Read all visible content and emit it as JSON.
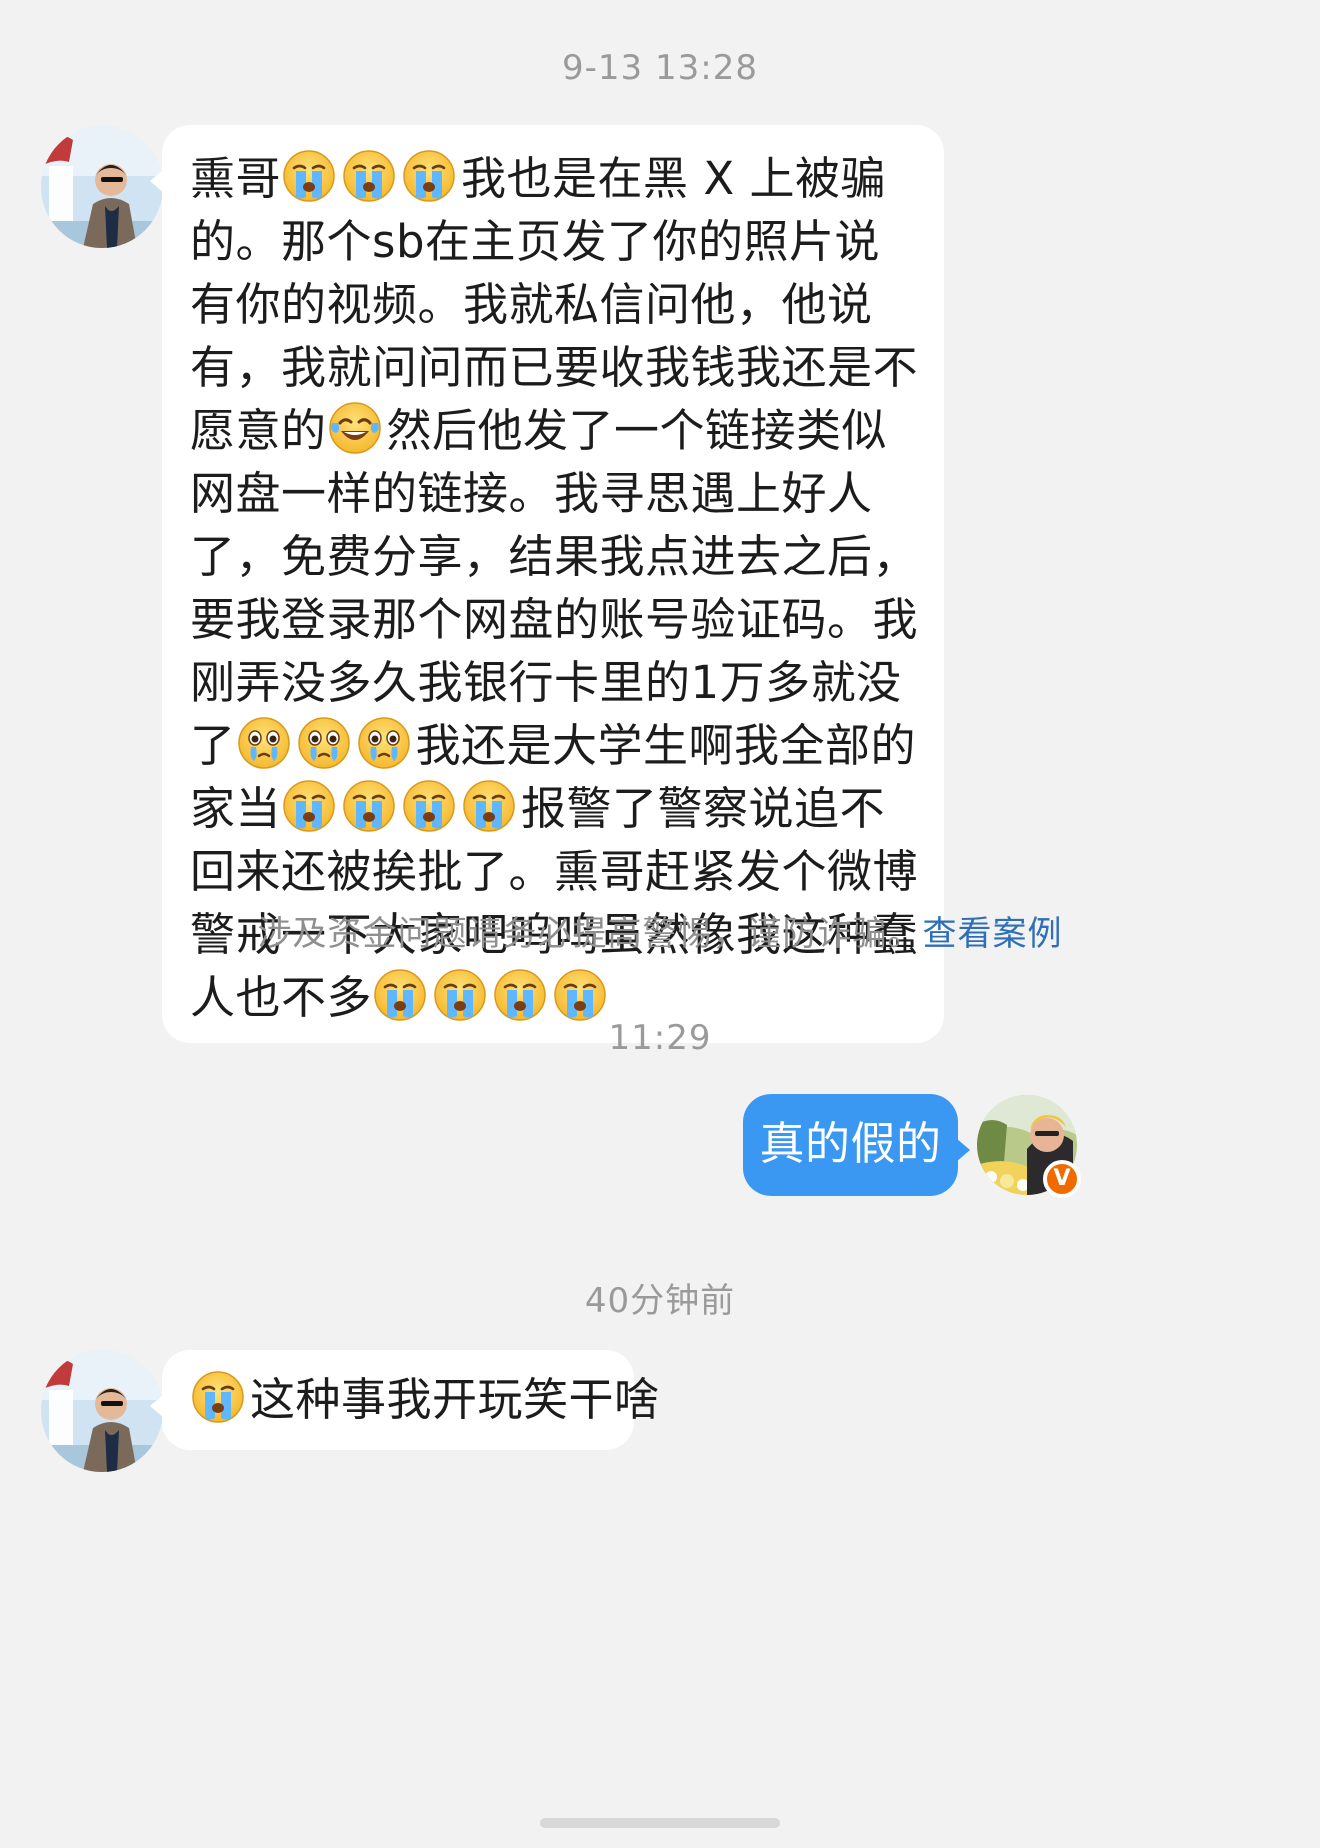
{
  "conversation": {
    "time_1": "9-13 13:28",
    "message_1": {
      "segments": [
        "熏哥",
        "cry",
        "cry",
        "cry",
        "我也是在黑 X 上被骗的。那个sb在主页发了你的照片说有你的视频。我就私信问他，他说有，我就问问而已要收我钱我还是不愿意的",
        "laughcry",
        "然后他发了一个链接类似网盘一样的链接。我寻思遇上好人了，免费分享，结果我点进去之后，要我登录那个网盘的账号验证码。我刚弄没多久我银行卡里的1万多就没了",
        "tears",
        "tears",
        "tears",
        "我还是大学生啊我全部的家当",
        "cry",
        "cry",
        "cry",
        "cry",
        "报警了警察说追不回来还被挨批了。熏哥赶紧发个微博警戒一下大家吧呜呜虽然像我这种蠢人也不多",
        "cry",
        "cry",
        "cry",
        "cry"
      ]
    },
    "notice_text": "涉及资金问题请务必提高警惕，谨防诈骗。",
    "notice_link": "查看案例",
    "time_2": "11:29",
    "message_2": "真的假的",
    "verified_badge": "V",
    "time_3": "40分钟前",
    "message_3": "这种事我开玩笑干啥"
  },
  "colors": {
    "background": "#f2f2f2",
    "incoming_bubble": "#ffffff",
    "outgoing_bubble": "#3a98f2",
    "link": "#2f6fb8",
    "timestamp": "#9a9a9a",
    "badge": "#f06a00"
  },
  "icons": {
    "cry": "crying-emoji-icon",
    "laughcry": "laughing-tears-emoji-icon",
    "tears": "teary-eyes-emoji-icon"
  }
}
